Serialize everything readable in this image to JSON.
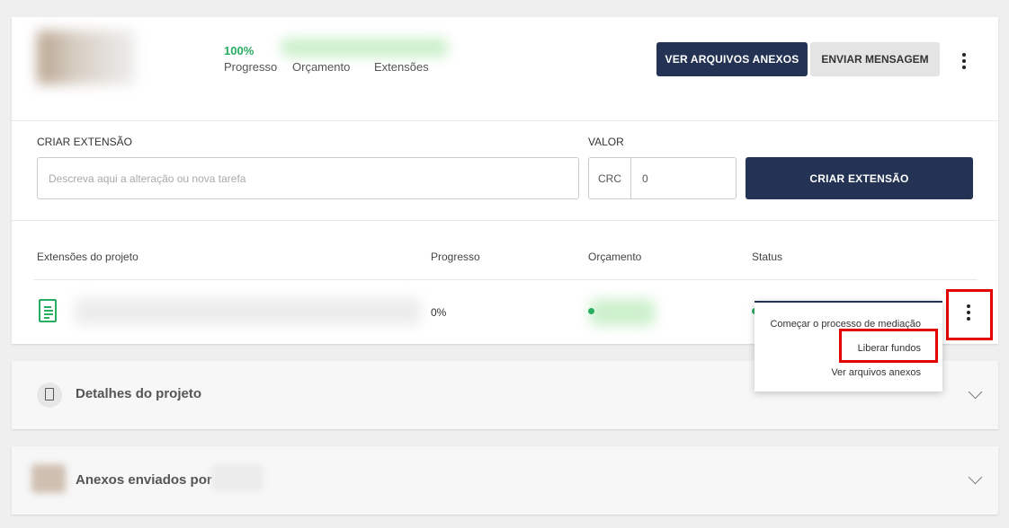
{
  "header": {
    "progress_pct": "100%",
    "stats": [
      "Progresso",
      "Orçamento",
      "Extensões"
    ],
    "btn_files": "VER ARQUIVOS ANEXOS",
    "btn_message": "ENVIAR MENSAGEM"
  },
  "create": {
    "label": "CRIAR EXTENSÃO",
    "placeholder": "Descreva aqui a alteração ou nova tarefa",
    "value_label": "VALOR",
    "currency": "CRC",
    "amount": "0",
    "btn": "CRIAR EXTENSÃO"
  },
  "table": {
    "headers": [
      "Extensões do projeto",
      "Progresso",
      "Orçamento",
      "Status"
    ],
    "row": {
      "progress": "0%"
    }
  },
  "menu": [
    "Começar o processo de mediação",
    "Liberar fundos",
    "Ver arquivos anexos"
  ],
  "sections": {
    "details": "Detalhes do projeto",
    "attachments": "Anexos enviados por"
  }
}
